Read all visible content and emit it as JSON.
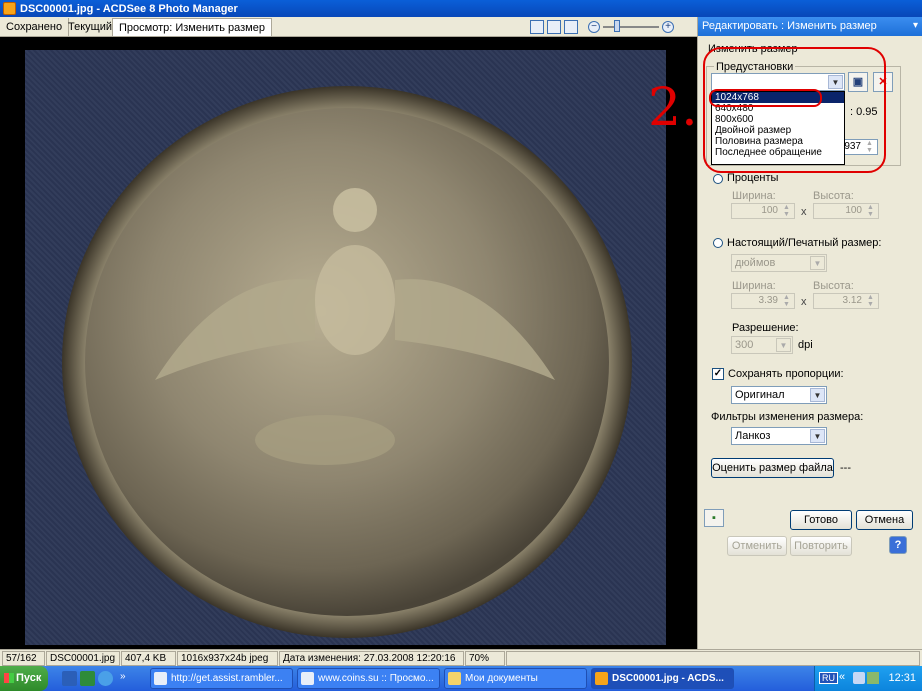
{
  "window": {
    "title": "DSC00001.jpg - ACDSee 8 Photo Manager"
  },
  "tabs": [
    {
      "label": "Сохранено"
    },
    {
      "label": "Текущий"
    },
    {
      "label": "Просмотр: Изменить размер"
    }
  ],
  "panel": {
    "header": "Редактировать : Изменить размер",
    "group_title": "Изменить размер",
    "presets_label": "Предустановки",
    "presets_value": "",
    "dropdown_items": [
      "1024x768",
      "640x480",
      "800x600",
      "Двойной размер",
      "Половина размера",
      "Последнее обращение"
    ],
    "partial_ratio": "0.95",
    "partial_height": "937",
    "percent_label": "Проценты",
    "width_label": "Ширина:",
    "height_label": "Высота:",
    "percent_width": "100",
    "percent_height": "100",
    "x": "x",
    "print_label": "Настоящий/Печатный размер:",
    "units_value": "дюймов",
    "print_width": "3.39",
    "print_height": "3.12",
    "resolution_label": "Разрешение:",
    "resolution_value": "300",
    "dpi": "dpi",
    "keep_ratio_label": "Сохранять пропорции:",
    "keep_ratio_value": "Оригинал",
    "filters_label": "Фильтры изменения размера:",
    "filter_value": "Ланкоз",
    "estimate_button": "Оценить размер файла",
    "estimate_value": "---",
    "done_button": "Готово",
    "cancel_button": "Отмена",
    "undo_button": "Отменить",
    "redo_button": "Повторить"
  },
  "annotation": {
    "number": "2."
  },
  "status": {
    "index": "57/162",
    "filename": "DSC00001.jpg",
    "filesize": "407,4 KB",
    "dims": "1016x937x24b jpeg",
    "modified": "Дата изменения: 27.03.2008 12:20:16",
    "zoom": "70%"
  },
  "taskbar": {
    "start": "Пуск",
    "tasks": [
      "http://get.assist.rambler...",
      "www.coins.su :: Просмо...",
      "Мои документы",
      "DSC00001.jpg - ACDS..."
    ],
    "tray_lang": "RU",
    "clock": "12:31"
  }
}
